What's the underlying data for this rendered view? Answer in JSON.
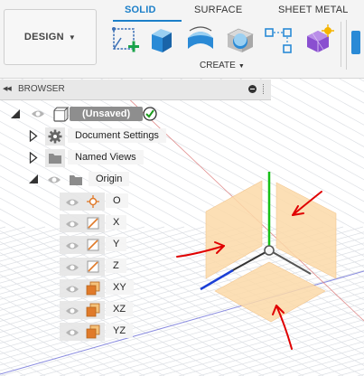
{
  "toolbar": {
    "workspace_label": "DESIGN",
    "tabs": [
      {
        "label": "SOLID",
        "active": true
      },
      {
        "label": "SURFACE",
        "active": false
      },
      {
        "label": "SHEET METAL",
        "active": false
      }
    ],
    "tools": [
      "create-sketch-icon",
      "extrude-icon",
      "revolve-icon",
      "hole-icon",
      "pattern-icon",
      "create-form-icon"
    ],
    "create_label": "CREATE"
  },
  "browser": {
    "title": "BROWSER",
    "root_label": "(Unsaved)",
    "items": [
      {
        "label": "Document Settings",
        "icon": "gear-icon"
      },
      {
        "label": "Named Views",
        "icon": "folder-icon"
      },
      {
        "label": "Origin",
        "icon": "folder-icon"
      }
    ],
    "origin_children": [
      {
        "label": "O",
        "icon": "origin-point-icon"
      },
      {
        "label": "X",
        "icon": "axis-icon"
      },
      {
        "label": "Y",
        "icon": "axis-icon"
      },
      {
        "label": "Z",
        "icon": "axis-icon"
      },
      {
        "label": "XY",
        "icon": "plane-icon"
      },
      {
        "label": "XZ",
        "icon": "plane-icon"
      },
      {
        "label": "YZ",
        "icon": "plane-icon"
      }
    ]
  },
  "colors": {
    "accent": "#1b7fc9",
    "plane_fill": "#fcd9a8",
    "x_axis": "#e03a3a",
    "y_axis": "#1fbf1f",
    "z_axis": "#1b3fd6",
    "annotation_arrow": "#e00000"
  }
}
